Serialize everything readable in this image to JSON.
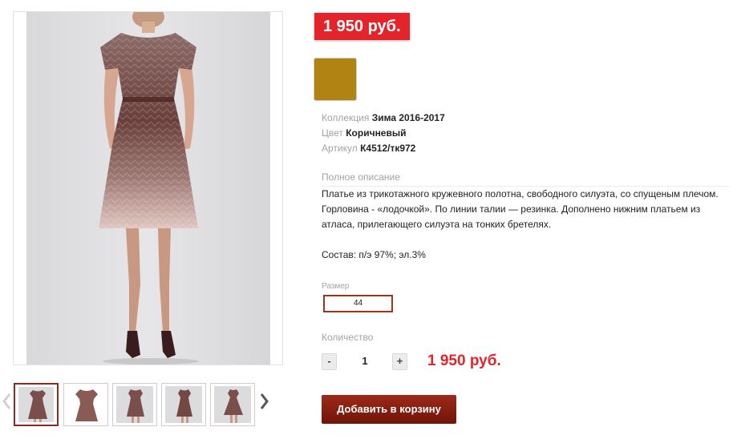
{
  "product": {
    "price_badge": "1 950 руб.",
    "color_swatch": "#b08312",
    "info": [
      {
        "label": "Коллекция",
        "value": "Зима 2016-2017"
      },
      {
        "label": "Цвет",
        "value": "Коричневый"
      },
      {
        "label": "Артикул",
        "value": "К4512/тк972"
      }
    ],
    "description_title": "Полное описание",
    "description_text": "Платье из трикотажного кружевного полотна, свободного силуэта, со спущеным плечом. Горловина - «лодочкой». По линии талии — резинка. Дополнено нижним платьем из атласа, прилегающего силуэта на тонких бретелях.",
    "composition": "Состав: п/э 97%; эл.3%",
    "size_label": "Размер",
    "size_value": "44",
    "qty_label": "Количество",
    "qty_minus": "-",
    "qty_value": "1",
    "qty_plus": "+",
    "price_total": "1 950 руб.",
    "add_to_cart": "Добавить в корзину"
  },
  "gallery": {
    "thumbnails": [
      "thumb-1",
      "thumb-2",
      "thumb-3",
      "thumb-4",
      "thumb-5"
    ],
    "active_index": 0,
    "prev_icon": "chevron-left-icon",
    "next_icon": "chevron-right-icon"
  },
  "colors": {
    "accent_red": "#e3242b",
    "button_brown": "#8a2416"
  }
}
